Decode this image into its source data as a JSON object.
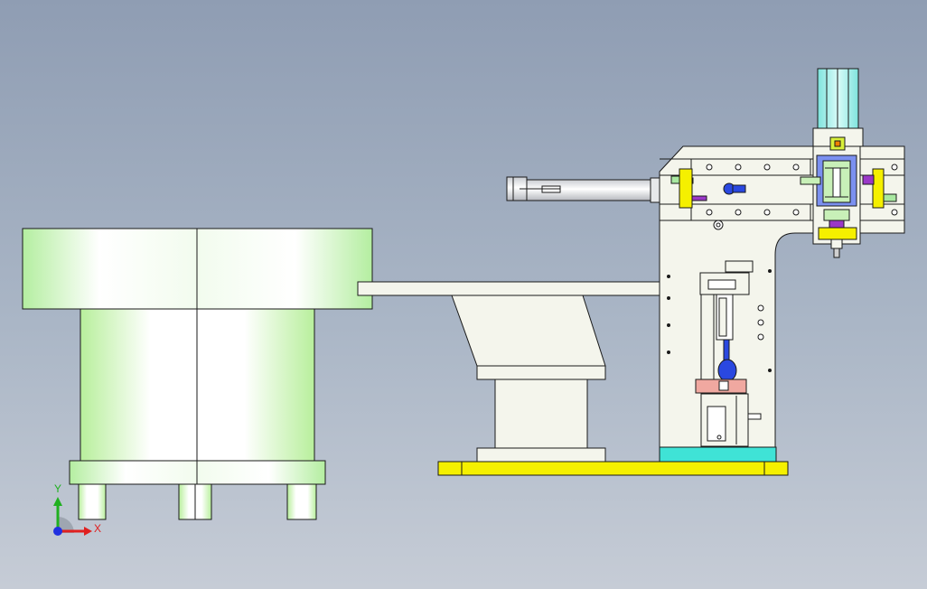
{
  "view": {
    "background_top": "#8f9db3",
    "background_bottom": "#c6ccd6"
  },
  "triad": {
    "x_label": "X",
    "y_label": "Y",
    "x_color": "#e02020",
    "y_color": "#20b020",
    "z_color": "#2030e0"
  },
  "colors": {
    "bowl_green": "#c8f5b4",
    "part_white": "#f4f5ec",
    "base_yellow": "#f5f000",
    "base_cyan": "#3fe3d6",
    "cylinder_cyan": "#9ff0ec",
    "accent_blue": "#2a48e0",
    "accent_purple": "#9a38c8",
    "accent_pink": "#f0a8a0",
    "outline": "#1a1a1a"
  }
}
